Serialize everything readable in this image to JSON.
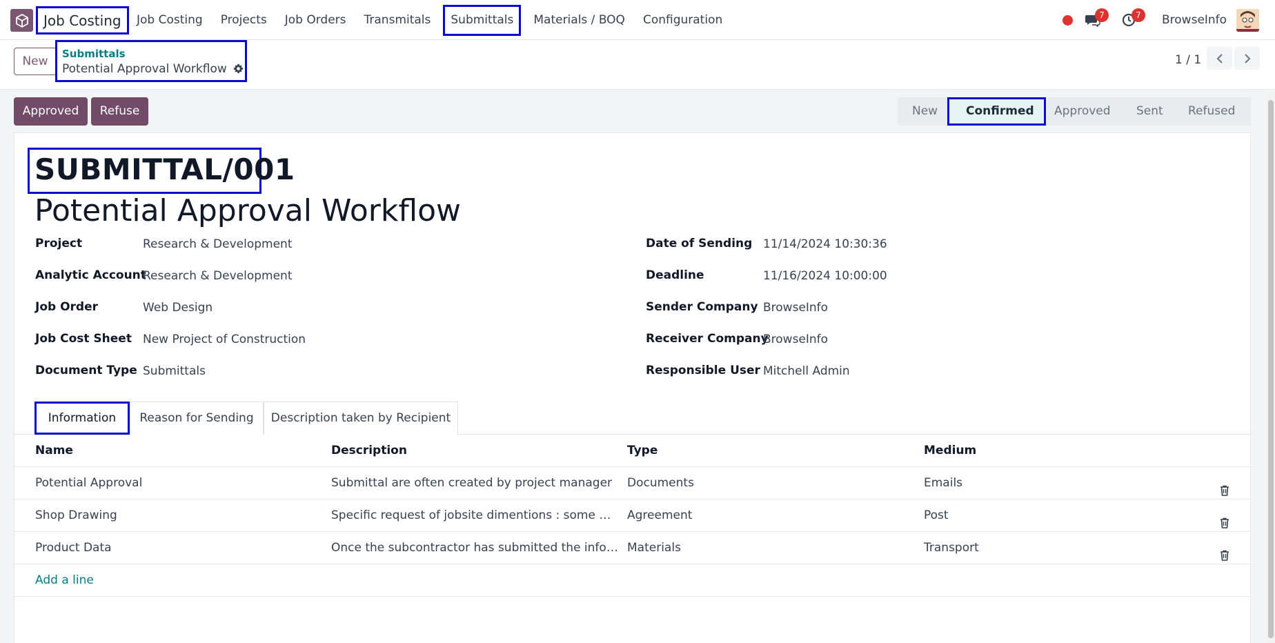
{
  "navbar": {
    "app_name": "Job Costing",
    "menu": [
      "Job Costing",
      "Projects",
      "Job Orders",
      "Transmitals",
      "Submittals",
      "Materials / BOQ",
      "Configuration"
    ],
    "messages_count": "7",
    "activities_count": "7",
    "company": "BrowseInfo"
  },
  "control_panel": {
    "new_label": "New",
    "breadcrumb_parent": "Submittals",
    "breadcrumb_current": "Potential Approval Workflow",
    "pager": "1 / 1"
  },
  "actions": {
    "approved_label": "Approved",
    "refuse_label": "Refuse"
  },
  "statusbar": {
    "steps": [
      "New",
      "Confirmed",
      "Approved",
      "Sent",
      "Refused"
    ],
    "active": "Confirmed"
  },
  "record": {
    "reference": "SUBMITTAL/001",
    "title": "Potential Approval Workflow"
  },
  "fields_left": [
    {
      "label": "Project",
      "value": "Research & Development"
    },
    {
      "label": "Analytic Account",
      "value": "Research & Development"
    },
    {
      "label": "Job Order",
      "value": "Web Design"
    },
    {
      "label": "Job Cost Sheet",
      "value": "New Project of Construction"
    },
    {
      "label": "Document Type",
      "value": "Submittals"
    }
  ],
  "fields_right": [
    {
      "label": "Date of Sending",
      "value": "11/14/2024 10:30:36"
    },
    {
      "label": "Deadline",
      "value": "11/16/2024 10:00:00"
    },
    {
      "label": "Sender Company",
      "value": "BrowseInfo"
    },
    {
      "label": "Receiver Company",
      "value": "BrowseInfo"
    },
    {
      "label": "Responsible User",
      "value": "Mitchell Admin"
    }
  ],
  "tabs": [
    "Information",
    "Reason for Sending",
    "Description taken by Recipient"
  ],
  "table": {
    "columns": [
      "Name",
      "Description",
      "Type",
      "Medium"
    ],
    "rows": [
      {
        "name": "Potential Approval",
        "description": "Submittal are often created by project manager",
        "type": "Documents",
        "medium": "Emails"
      },
      {
        "name": "Shop Drawing",
        "description": "Specific request of jobsite dimentions : some mate…",
        "type": "Agreement",
        "medium": "Post"
      },
      {
        "name": "Product Data",
        "description": "Once the subcontractor has submitted the inform…",
        "type": "Materials",
        "medium": "Transport"
      }
    ],
    "add_line": "Add a line"
  },
  "colors": {
    "brand": "#714b67",
    "link": "#017e84",
    "highlight_box": "#0a0ad4",
    "badge": "#e03131"
  },
  "icons": [
    "app-logo-icon",
    "chat-icon",
    "clock-icon",
    "gear-icon",
    "chevron-left-icon",
    "chevron-right-icon",
    "trash-icon"
  ]
}
